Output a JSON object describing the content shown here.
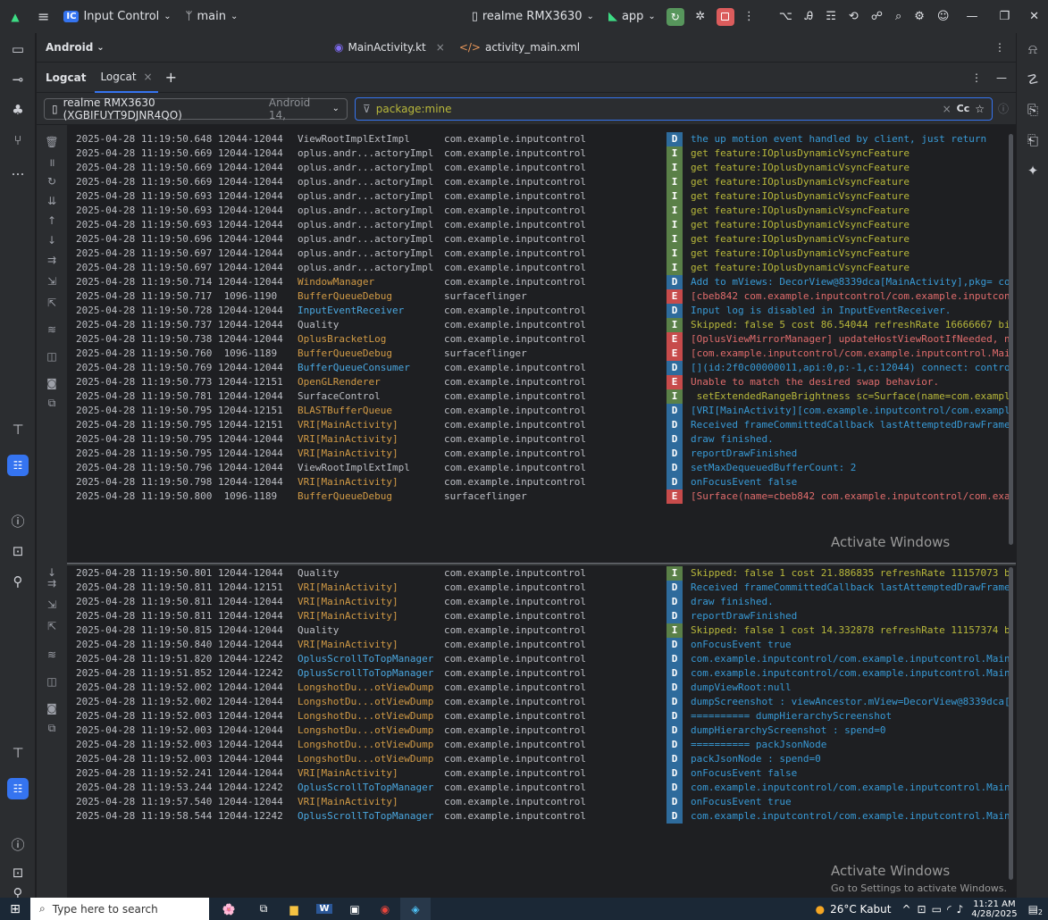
{
  "titlebar": {
    "project_badge": "IC",
    "project": "Input Control",
    "branch": "main",
    "device": "realme RMX3630",
    "run_config": "app"
  },
  "editor_tabs": {
    "project_view": "Android",
    "tabs": [
      "MainActivity.kt",
      "activity_main.xml"
    ]
  },
  "logcat": {
    "panel_title": "Logcat",
    "tab_label": "Logcat",
    "device_selector": "realme RMX3630 (XGBIFUYT9DJNR4QO)",
    "device_selector_suffix": "Android 14,",
    "filter_query": "package:mine",
    "case_label": "Cc"
  },
  "colors": {
    "level_D": "#2e6b9c",
    "level_I": "#5a8048",
    "level_E": "#c74b4b",
    "msg_D": "#389ad6",
    "msg_I": "#b8b83b",
    "msg_E": "#e06c6c",
    "tag_orange": "#d19a45",
    "tag_blue": "#4aa7e0",
    "tag_gray": "#bcbec4"
  },
  "log_rows_top": [
    {
      "dt": "2025-04-28 11:19:50.648 12044-12044",
      "tag": "ViewRootImplExtImpl",
      "tagc": "gray",
      "pkg": "com.example.inputcontrol",
      "lvl": "D",
      "msg": "the up motion event handled by client, just return"
    },
    {
      "dt": "2025-04-28 11:19:50.669 12044-12044",
      "tag": "oplus.andr...actoryImpl",
      "tagc": "gray",
      "pkg": "com.example.inputcontrol",
      "lvl": "I",
      "msg": "get feature:IOplusDynamicVsyncFeature"
    },
    {
      "dt": "2025-04-28 11:19:50.669 12044-12044",
      "tag": "oplus.andr...actoryImpl",
      "tagc": "gray",
      "pkg": "com.example.inputcontrol",
      "lvl": "I",
      "msg": "get feature:IOplusDynamicVsyncFeature"
    },
    {
      "dt": "2025-04-28 11:19:50.669 12044-12044",
      "tag": "oplus.andr...actoryImpl",
      "tagc": "gray",
      "pkg": "com.example.inputcontrol",
      "lvl": "I",
      "msg": "get feature:IOplusDynamicVsyncFeature"
    },
    {
      "dt": "2025-04-28 11:19:50.693 12044-12044",
      "tag": "oplus.andr...actoryImpl",
      "tagc": "gray",
      "pkg": "com.example.inputcontrol",
      "lvl": "I",
      "msg": "get feature:IOplusDynamicVsyncFeature"
    },
    {
      "dt": "2025-04-28 11:19:50.693 12044-12044",
      "tag": "oplus.andr...actoryImpl",
      "tagc": "gray",
      "pkg": "com.example.inputcontrol",
      "lvl": "I",
      "msg": "get feature:IOplusDynamicVsyncFeature"
    },
    {
      "dt": "2025-04-28 11:19:50.693 12044-12044",
      "tag": "oplus.andr...actoryImpl",
      "tagc": "gray",
      "pkg": "com.example.inputcontrol",
      "lvl": "I",
      "msg": "get feature:IOplusDynamicVsyncFeature"
    },
    {
      "dt": "2025-04-28 11:19:50.696 12044-12044",
      "tag": "oplus.andr...actoryImpl",
      "tagc": "gray",
      "pkg": "com.example.inputcontrol",
      "lvl": "I",
      "msg": "get feature:IOplusDynamicVsyncFeature"
    },
    {
      "dt": "2025-04-28 11:19:50.697 12044-12044",
      "tag": "oplus.andr...actoryImpl",
      "tagc": "gray",
      "pkg": "com.example.inputcontrol",
      "lvl": "I",
      "msg": "get feature:IOplusDynamicVsyncFeature"
    },
    {
      "dt": "2025-04-28 11:19:50.697 12044-12044",
      "tag": "oplus.andr...actoryImpl",
      "tagc": "gray",
      "pkg": "com.example.inputcontrol",
      "lvl": "I",
      "msg": "get feature:IOplusDynamicVsyncFeature"
    },
    {
      "dt": "2025-04-28 11:19:50.714 12044-12044",
      "tag": "WindowManager",
      "tagc": "orange",
      "pkg": "com.example.inputcontrol",
      "lvl": "D",
      "msg": "Add to mViews: DecorView@8339dca[MainActivity],pkg= co"
    },
    {
      "dt": "2025-04-28 11:19:50.717  1096-1190",
      "tag": "BufferQueueDebug",
      "tagc": "orange",
      "pkg": "surfaceflinger",
      "lvl": "E",
      "msg": "[cbeb842 com.example.inputcontrol/com.example.inputcon"
    },
    {
      "dt": "2025-04-28 11:19:50.728 12044-12044",
      "tag": "InputEventReceiver",
      "tagc": "blue",
      "pkg": "com.example.inputcontrol",
      "lvl": "D",
      "msg": "Input log is disabled in InputEventReceiver."
    },
    {
      "dt": "2025-04-28 11:19:50.737 12044-12044",
      "tag": "Quality",
      "tagc": "gray",
      "pkg": "com.example.inputcontrol",
      "lvl": "I",
      "msg": "Skipped: false 5 cost 86.54044 refreshRate 16666667 bi"
    },
    {
      "dt": "2025-04-28 11:19:50.738 12044-12044",
      "tag": "OplusBracketLog",
      "tagc": "orange",
      "pkg": "com.example.inputcontrol",
      "lvl": "E",
      "msg": "[OplusViewMirrorManager] updateHostViewRootIfNeeded, n"
    },
    {
      "dt": "2025-04-28 11:19:50.760  1096-1189",
      "tag": "BufferQueueDebug",
      "tagc": "orange",
      "pkg": "surfaceflinger",
      "lvl": "E",
      "msg": "[com.example.inputcontrol/com.example.inputcontrol.Mai"
    },
    {
      "dt": "2025-04-28 11:19:50.769 12044-12044",
      "tag": "BufferQueueConsumer",
      "tagc": "blue",
      "pkg": "com.example.inputcontrol",
      "lvl": "D",
      "msg": "[](id:2f0c00000011,api:0,p:-1,c:12044) connect: contro"
    },
    {
      "dt": "2025-04-28 11:19:50.773 12044-12151",
      "tag": "OpenGLRenderer",
      "tagc": "orange",
      "pkg": "com.example.inputcontrol",
      "lvl": "E",
      "msg": "Unable to match the desired swap behavior."
    },
    {
      "dt": "2025-04-28 11:19:50.781 12044-12044",
      "tag": "SurfaceControl",
      "tagc": "gray",
      "pkg": "com.example.inputcontrol",
      "lvl": "I",
      "msg": " setExtendedRangeBrightness sc=Surface(name=com.exampl"
    },
    {
      "dt": "2025-04-28 11:19:50.795 12044-12151",
      "tag": "BLASTBufferQueue",
      "tagc": "orange",
      "pkg": "com.example.inputcontrol",
      "lvl": "D",
      "msg": "[VRI[MainActivity][com.example.inputcontrol/com.exampl"
    },
    {
      "dt": "2025-04-28 11:19:50.795 12044-12151",
      "tag": "VRI[MainActivity]",
      "tagc": "orange",
      "pkg": "com.example.inputcontrol",
      "lvl": "D",
      "msg": "Received frameCommittedCallback lastAttemptedDrawFrame"
    },
    {
      "dt": "2025-04-28 11:19:50.795 12044-12044",
      "tag": "VRI[MainActivity]",
      "tagc": "orange",
      "pkg": "com.example.inputcontrol",
      "lvl": "D",
      "msg": "draw finished."
    },
    {
      "dt": "2025-04-28 11:19:50.795 12044-12044",
      "tag": "VRI[MainActivity]",
      "tagc": "orange",
      "pkg": "com.example.inputcontrol",
      "lvl": "D",
      "msg": "reportDrawFinished"
    },
    {
      "dt": "2025-04-28 11:19:50.796 12044-12044",
      "tag": "ViewRootImplExtImpl",
      "tagc": "gray",
      "pkg": "com.example.inputcontrol",
      "lvl": "D",
      "msg": "setMaxDequeuedBufferCount: 2"
    },
    {
      "dt": "2025-04-28 11:19:50.798 12044-12044",
      "tag": "VRI[MainActivity]",
      "tagc": "orange",
      "pkg": "com.example.inputcontrol",
      "lvl": "D",
      "msg": "onFocusEvent false"
    },
    {
      "dt": "2025-04-28 11:19:50.800  1096-1189",
      "tag": "BufferQueueDebug",
      "tagc": "orange",
      "pkg": "surfaceflinger",
      "lvl": "E",
      "msg": "[Surface(name=cbeb842 com.example.inputcontrol/com.exa"
    }
  ],
  "log_rows_bottom": [
    {
      "dt": "2025-04-28 11:19:50.801 12044-12044",
      "tag": "Quality",
      "tagc": "gray",
      "pkg": "com.example.inputcontrol",
      "lvl": "I",
      "msg": "Skipped: false 1 cost 21.886835 refreshRate 11157073 b"
    },
    {
      "dt": "2025-04-28 11:19:50.811 12044-12151",
      "tag": "VRI[MainActivity]",
      "tagc": "orange",
      "pkg": "com.example.inputcontrol",
      "lvl": "D",
      "msg": "Received frameCommittedCallback lastAttemptedDrawFrame"
    },
    {
      "dt": "2025-04-28 11:19:50.811 12044-12044",
      "tag": "VRI[MainActivity]",
      "tagc": "orange",
      "pkg": "com.example.inputcontrol",
      "lvl": "D",
      "msg": "draw finished."
    },
    {
      "dt": "2025-04-28 11:19:50.811 12044-12044",
      "tag": "VRI[MainActivity]",
      "tagc": "orange",
      "pkg": "com.example.inputcontrol",
      "lvl": "D",
      "msg": "reportDrawFinished"
    },
    {
      "dt": "2025-04-28 11:19:50.815 12044-12044",
      "tag": "Quality",
      "tagc": "gray",
      "pkg": "com.example.inputcontrol",
      "lvl": "I",
      "msg": "Skipped: false 1 cost 14.332878 refreshRate 11157374 b"
    },
    {
      "dt": "2025-04-28 11:19:50.840 12044-12044",
      "tag": "VRI[MainActivity]",
      "tagc": "orange",
      "pkg": "com.example.inputcontrol",
      "lvl": "D",
      "msg": "onFocusEvent true"
    },
    {
      "dt": "2025-04-28 11:19:51.820 12044-12242",
      "tag": "OplusScrollToTopManager",
      "tagc": "blue",
      "pkg": "com.example.inputcontrol",
      "lvl": "D",
      "msg": "com.example.inputcontrol/com.example.inputcontrol.Main"
    },
    {
      "dt": "2025-04-28 11:19:51.852 12044-12242",
      "tag": "OplusScrollToTopManager",
      "tagc": "blue",
      "pkg": "com.example.inputcontrol",
      "lvl": "D",
      "msg": "com.example.inputcontrol/com.example.inputcontrol.Main"
    },
    {
      "dt": "2025-04-28 11:19:52.002 12044-12044",
      "tag": "LongshotDu...otViewDump",
      "tagc": "orange",
      "pkg": "com.example.inputcontrol",
      "lvl": "D",
      "msg": "dumpViewRoot:null"
    },
    {
      "dt": "2025-04-28 11:19:52.002 12044-12044",
      "tag": "LongshotDu...otViewDump",
      "tagc": "orange",
      "pkg": "com.example.inputcontrol",
      "lvl": "D",
      "msg": "dumpScreenshot : viewAncestor.mView=DecorView@8339dca["
    },
    {
      "dt": "2025-04-28 11:19:52.003 12044-12044",
      "tag": "LongshotDu...otViewDump",
      "tagc": "orange",
      "pkg": "com.example.inputcontrol",
      "lvl": "D",
      "msg": "========== dumpHierarchyScreenshot"
    },
    {
      "dt": "2025-04-28 11:19:52.003 12044-12044",
      "tag": "LongshotDu...otViewDump",
      "tagc": "orange",
      "pkg": "com.example.inputcontrol",
      "lvl": "D",
      "msg": "dumpHierarchyScreenshot : spend=0"
    },
    {
      "dt": "2025-04-28 11:19:52.003 12044-12044",
      "tag": "LongshotDu...otViewDump",
      "tagc": "orange",
      "pkg": "com.example.inputcontrol",
      "lvl": "D",
      "msg": "========== packJsonNode"
    },
    {
      "dt": "2025-04-28 11:19:52.003 12044-12044",
      "tag": "LongshotDu...otViewDump",
      "tagc": "orange",
      "pkg": "com.example.inputcontrol",
      "lvl": "D",
      "msg": "packJsonNode : spend=0"
    },
    {
      "dt": "2025-04-28 11:19:52.241 12044-12044",
      "tag": "VRI[MainActivity]",
      "tagc": "orange",
      "pkg": "com.example.inputcontrol",
      "lvl": "D",
      "msg": "onFocusEvent false"
    },
    {
      "dt": "2025-04-28 11:19:53.244 12044-12242",
      "tag": "OplusScrollToTopManager",
      "tagc": "blue",
      "pkg": "com.example.inputcontrol",
      "lvl": "D",
      "msg": "com.example.inputcontrol/com.example.inputcontrol.Main"
    },
    {
      "dt": "2025-04-28 11:19:57.540 12044-12044",
      "tag": "VRI[MainActivity]",
      "tagc": "orange",
      "pkg": "com.example.inputcontrol",
      "lvl": "D",
      "msg": "onFocusEvent true"
    },
    {
      "dt": "2025-04-28 11:19:58.544 12044-12242",
      "tag": "OplusScrollToTopManager",
      "tagc": "blue",
      "pkg": "com.example.inputcontrol",
      "lvl": "D",
      "msg": "com.example.inputcontrol/com.example.inputcontrol.Main"
    }
  ],
  "watermark": {
    "line1": "Activate Windows",
    "line2": "Go to Settings to activate Windows."
  },
  "taskbar": {
    "search_placeholder": "Type here to search",
    "weather": "26°C Kabut",
    "time": "11:21 AM",
    "date": "4/28/2025",
    "notif_count": "2"
  }
}
